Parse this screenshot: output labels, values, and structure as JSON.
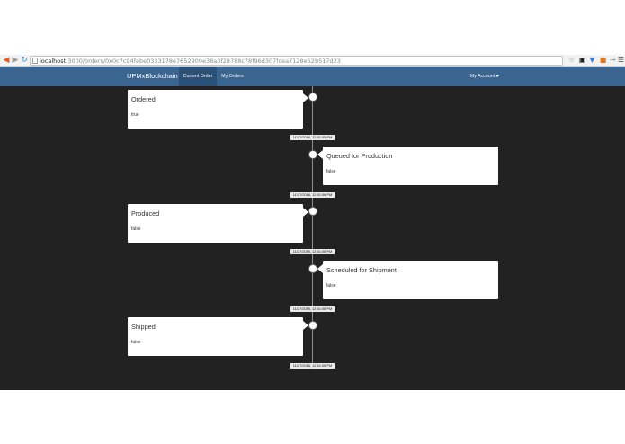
{
  "browser": {
    "url_host": "localhost",
    "url_rest": ":3000/orders/0x0c7c94febe0333178e7652909e38a3f28788c78f96d307fcea7128e52b517d23",
    "icons": {
      "back": "arrow-left-icon",
      "forward": "arrow-right-icon",
      "reload": "reload-icon",
      "page": "page-icon",
      "bookmark": "star-icon",
      "pocket": "pocket-icon",
      "vpn": "shield-icon",
      "extension": "extension-icon",
      "extension2": "extension-icon",
      "menu": "hamburger-menu-icon"
    }
  },
  "navbar": {
    "brand": "UPMxBlockchain",
    "items": [
      {
        "label": "Current Order",
        "active": true
      },
      {
        "label": "My Orders",
        "active": false
      }
    ],
    "account": "My Account"
  },
  "timeline": {
    "entries": [
      {
        "title": "Ordered",
        "value": "true",
        "timestamp": "11/27/2016, 12:51:05 PM"
      },
      {
        "title": "Queued for Production",
        "value": "false",
        "timestamp": "11/27/2016, 12:51:06 PM"
      },
      {
        "title": "Produced",
        "value": "false",
        "timestamp": "11/27/2016, 12:51:06 PM"
      },
      {
        "title": "Scheduled for Shipment",
        "value": "false",
        "timestamp": "11/27/2016, 12:51:06 PM"
      },
      {
        "title": "Shipped",
        "value": "false",
        "timestamp": "11/27/2016, 12:51:06 PM"
      }
    ]
  },
  "colors": {
    "navbar": "#3a6591",
    "navbar_active": "#2c5178",
    "background": "#222222",
    "panel": "#ffffff",
    "chrome_back_arrow": "#e05a2b",
    "chrome_reload": "#3a7bd5"
  }
}
